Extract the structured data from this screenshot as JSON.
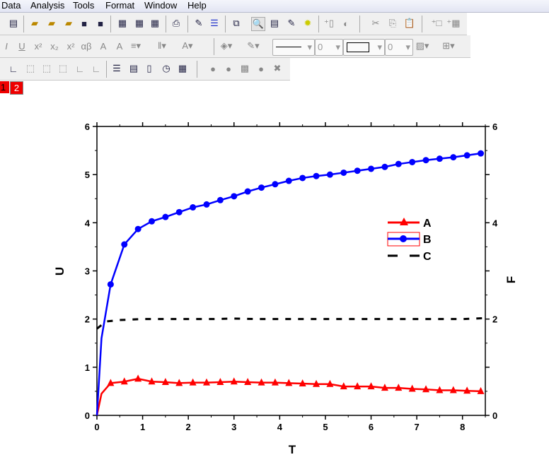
{
  "menu": [
    "Data",
    "Analysis",
    "Tools",
    "Format",
    "Window",
    "Help"
  ],
  "toolbar": {
    "line_width": "0",
    "border_width": "0"
  },
  "tabs": [
    "1",
    "2"
  ],
  "chart_data": {
    "type": "line",
    "xlabel": "T",
    "ylabel": "U",
    "y2label": "F",
    "xlim": [
      0,
      8.5
    ],
    "ylim": [
      0,
      6
    ],
    "y2lim": [
      0,
      6
    ],
    "xticks": [
      "0",
      "1",
      "2",
      "3",
      "4",
      "5",
      "6",
      "7",
      "8"
    ],
    "yticks": [
      "0",
      "1",
      "2",
      "3",
      "4",
      "5",
      "6"
    ],
    "y2ticks": [
      "0",
      "2",
      "4",
      "6"
    ],
    "legend": {
      "placement": "right-middle",
      "entries": [
        "A",
        "B",
        "C"
      ]
    },
    "series": [
      {
        "name": "A",
        "color": "#ff0000",
        "marker": "triangle",
        "x": [
          0,
          0.1,
          0.3,
          0.6,
          0.9,
          1.2,
          1.5,
          1.8,
          2.1,
          2.4,
          2.7,
          3.0,
          3.3,
          3.6,
          3.9,
          4.2,
          4.5,
          4.8,
          5.1,
          5.4,
          5.7,
          6.0,
          6.3,
          6.6,
          6.9,
          7.2,
          7.5,
          7.8,
          8.1,
          8.4
        ],
        "y": [
          0,
          0.45,
          0.67,
          0.7,
          0.76,
          0.7,
          0.69,
          0.67,
          0.68,
          0.68,
          0.69,
          0.7,
          0.69,
          0.68,
          0.68,
          0.67,
          0.66,
          0.65,
          0.65,
          0.6,
          0.6,
          0.6,
          0.57,
          0.57,
          0.55,
          0.54,
          0.52,
          0.52,
          0.51,
          0.5
        ]
      },
      {
        "name": "B",
        "color": "#0000ff",
        "marker": "circle",
        "x": [
          0,
          0.1,
          0.3,
          0.6,
          0.9,
          1.2,
          1.5,
          1.8,
          2.1,
          2.4,
          2.7,
          3.0,
          3.3,
          3.6,
          3.9,
          4.2,
          4.5,
          4.8,
          5.1,
          5.4,
          5.7,
          6.0,
          6.3,
          6.6,
          6.9,
          7.2,
          7.5,
          7.8,
          8.1,
          8.4
        ],
        "y": [
          0,
          1.6,
          2.72,
          3.55,
          3.87,
          4.03,
          4.12,
          4.22,
          4.32,
          4.38,
          4.47,
          4.55,
          4.65,
          4.73,
          4.8,
          4.87,
          4.93,
          4.97,
          5.0,
          5.04,
          5.08,
          5.12,
          5.16,
          5.22,
          5.26,
          5.3,
          5.33,
          5.36,
          5.4,
          5.44
        ]
      },
      {
        "name": "C",
        "color": "#000000",
        "marker": "dash",
        "x": [
          0,
          0.2,
          0.5,
          1,
          1.5,
          2,
          2.5,
          3,
          3.5,
          4,
          4.5,
          5,
          5.5,
          6,
          6.5,
          7,
          7.5,
          8,
          8.5
        ],
        "y": [
          1.8,
          1.95,
          1.98,
          2.0,
          2.0,
          2.0,
          2.0,
          2.01,
          2.0,
          2.0,
          2.0,
          2.0,
          2.0,
          2.0,
          2.0,
          2.0,
          2.0,
          2.0,
          2.02
        ]
      }
    ]
  }
}
